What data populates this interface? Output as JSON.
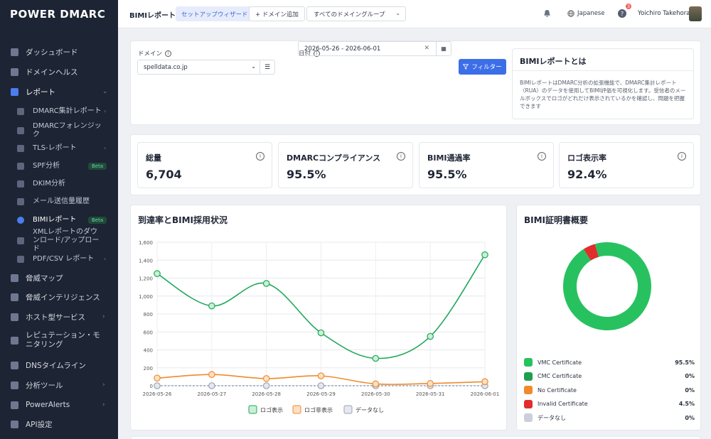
{
  "sidebar": {
    "logo": "POWER DMARC",
    "items": [
      {
        "label": "ダッシュボード"
      },
      {
        "label": "ドメインヘルス"
      },
      {
        "label": "レポート"
      },
      {
        "label": "脅威マップ"
      },
      {
        "label": "脅威インテリジェンス"
      },
      {
        "label": "ホスト型サービス"
      },
      {
        "label": "レピュテーション・モニタリング"
      },
      {
        "label": "DNSタイムライン"
      },
      {
        "label": "分析ツール"
      },
      {
        "label": "PowerAlerts"
      },
      {
        "label": "API設定"
      }
    ],
    "sub_items": [
      {
        "label": "DMARC集計レポート"
      },
      {
        "label": "DMARCフォレンジック"
      },
      {
        "label": "TLS-レポート"
      },
      {
        "label": "SPF分析",
        "badge": "Beta"
      },
      {
        "label": "DKIM分析"
      },
      {
        "label": "メール送信量履歴"
      },
      {
        "label": "BIMIレポート",
        "badge": "Beta"
      },
      {
        "label": "XMLレポートのダウンロード/アップロード"
      },
      {
        "label": "PDF/CSV レポート"
      }
    ]
  },
  "topbar": {
    "title": "BIMIレポート",
    "wizard": "セットアップウィザード",
    "add_domain": "+ ドメイン追加",
    "domain_group": "すべてのドメイングループ",
    "language": "Japanese",
    "notif_count": "3",
    "user": "Yoichiro Takehora"
  },
  "filters": {
    "domain_label": "ドメイン",
    "domain_value": "spelldata.co.jp",
    "date_label": "日付",
    "date_value": "2026-05-26 - 2026-06-01",
    "filter_button": "フィルター"
  },
  "about": {
    "title": "BIMIレポートとは",
    "desc": "BIMIレポートはDMARC分析の拡張機能で、DMARC集計レポート（RUA）のデータを使用してBIMI評価を可視化します。受信者のメールボックスでロゴがどれだけ表示されているかを確認し、問題を把握できます"
  },
  "kpis": [
    {
      "label": "総量",
      "value": "6,704"
    },
    {
      "label": "DMARCコンプライアンス",
      "value": "95.5%"
    },
    {
      "label": "BIMI通過率",
      "value": "95.5%"
    },
    {
      "label": "ロゴ表示率",
      "value": "92.4%"
    }
  ],
  "chart_title": "到達率とBIMI採用状況",
  "chart_data": {
    "type": "line",
    "x": [
      "2026-05-26",
      "2026-05-27",
      "2026-05-28",
      "2026-05-29",
      "2026-05-30",
      "2026-05-31",
      "2026-06-01"
    ],
    "ylim": [
      0,
      1600
    ],
    "yticks": [
      "0",
      "200",
      "400",
      "600",
      "800",
      "1,000",
      "1,200",
      "1,400",
      "1,600"
    ],
    "grid": true,
    "legend": "bottom",
    "series": [
      {
        "name": "ロゴ表示",
        "color": "#1fa85a",
        "values": [
          1250,
          890,
          1140,
          590,
          305,
          550,
          1460
        ]
      },
      {
        "name": "ロゴ非表示",
        "color": "#f08a2c",
        "values": [
          85,
          125,
          80,
          110,
          20,
          25,
          45
        ]
      },
      {
        "name": "データなし",
        "color": "#9aa3b5",
        "values": [
          0,
          0,
          0,
          0,
          0,
          0,
          0
        ]
      }
    ]
  },
  "cert": {
    "title": "BIMI証明書概要",
    "items": [
      {
        "label": "VMC Certificate",
        "pct": "95.5%",
        "value": 95.5,
        "color": "#27c25f"
      },
      {
        "label": "CMC Certificate",
        "pct": "0%",
        "value": 0,
        "color": "#1e9e4f"
      },
      {
        "label": "No Certificate",
        "pct": "0%",
        "value": 0,
        "color": "#f08a2c"
      },
      {
        "label": "Invalid Certificate",
        "pct": "4.5%",
        "value": 4.5,
        "color": "#e02d2d"
      },
      {
        "label": "データなし",
        "pct": "0%",
        "value": 0,
        "color": "#c9d0db"
      }
    ]
  }
}
